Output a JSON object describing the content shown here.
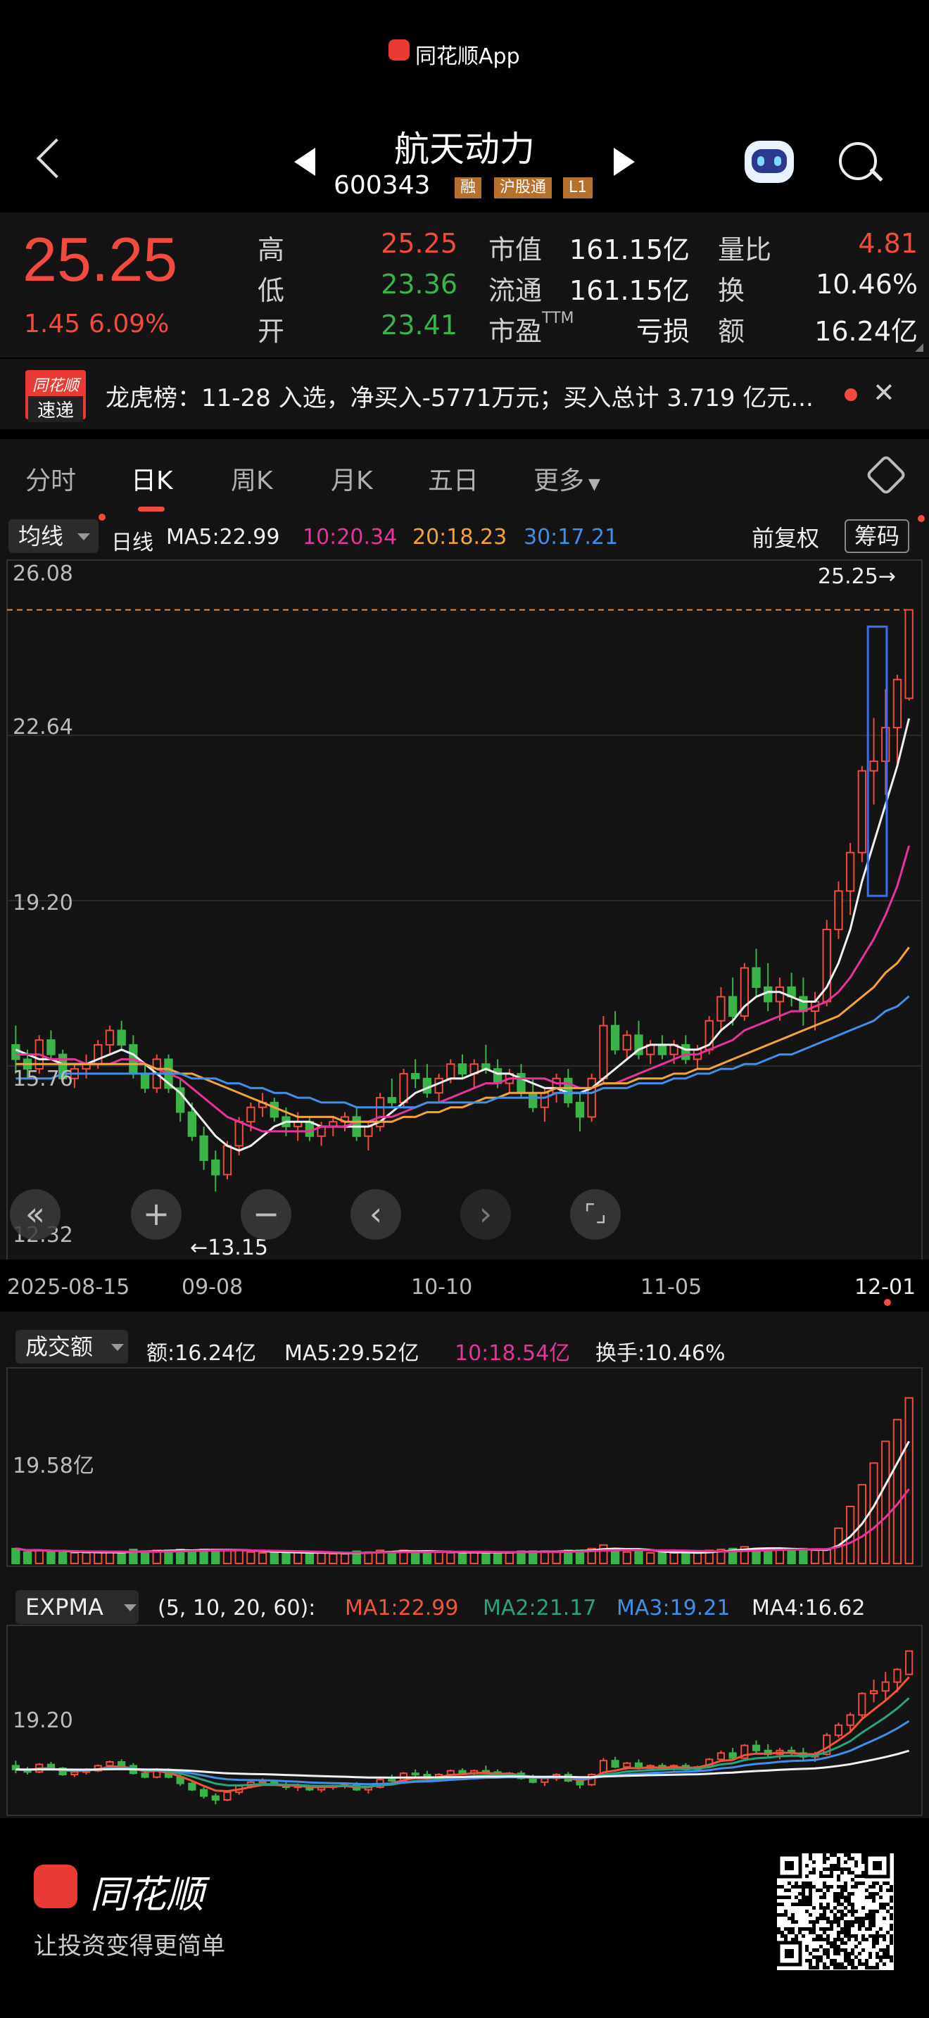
{
  "brand": {
    "app_name": "同花顺App"
  },
  "nav": {
    "stock_name": "航天动力",
    "stock_code": "600343",
    "tags": [
      "融",
      "沪股通",
      "L1"
    ]
  },
  "quote": {
    "price": "25.25",
    "change": "1.45",
    "change_pct": "6.09%",
    "rows": [
      {
        "l1": "高",
        "v1": "25.25",
        "l2": "市值",
        "v2": "161.15亿",
        "l3": "量比",
        "v3": "4.81"
      },
      {
        "l1": "低",
        "v1": "23.36",
        "l2": "流通",
        "v2": "161.15亿",
        "l3": "换",
        "v3": "10.46%"
      },
      {
        "l1": "开",
        "v1": "23.41",
        "l2": "市盈",
        "l2_sup": "TTM",
        "v2": "亏损",
        "l3": "额",
        "v3": "16.24亿"
      }
    ]
  },
  "ticker": {
    "badge_top": "同花顺",
    "badge_bottom": "速递",
    "text": "龙虎榜：11-28 入选，净买入-5771万元；买入总计 3.719 亿元..."
  },
  "tabs": [
    "分时",
    "日K",
    "周K",
    "月K",
    "五日",
    "更多"
  ],
  "active_tab": "日K",
  "kline": {
    "indicator": "均线",
    "period": "日线",
    "ma5": "MA5:22.99",
    "ma10": "10:20.34",
    "ma20": "20:18.23",
    "ma30": "30:17.21",
    "adjust": "前复权",
    "chip": "筹码",
    "y_labels": [
      "26.08",
      "22.64",
      "19.20",
      "15.76",
      "12.32"
    ],
    "high_mark": "25.25→",
    "low_mark": "←13.15",
    "x_labels": [
      "2025-08-15",
      "09-08",
      "10-10",
      "11-05",
      "12-01"
    ]
  },
  "volume": {
    "indicator": "成交额",
    "amount": "额:16.24亿",
    "ma5": "MA5:29.52亿",
    "ma10": "10:18.54亿",
    "turnover": "换手:10.46%",
    "y_label": "19.58亿"
  },
  "expma": {
    "indicator": "EXPMA",
    "params": "(5, 10, 20, 60):",
    "ma1": "MA1:22.99",
    "ma2": "MA2:21.17",
    "ma3": "MA3:19.21",
    "ma4": "MA4:16.62",
    "y_label": "19.20"
  },
  "footer": {
    "brand": "同花顺",
    "slogan": "让投资变得更简单"
  },
  "colors": {
    "up": "#f24a3d",
    "down": "#38b449",
    "ma5": "#f0f0f0",
    "ma10": "#e6349a",
    "ma20": "#f2a33a",
    "ma30": "#3f8fe8",
    "expma_ma2": "#2aa37a"
  },
  "chart_data": {
    "type": "candlestick",
    "title": "航天动力 日K",
    "x": [
      "2025-08-15",
      "09-08",
      "10-10",
      "11-05",
      "12-01"
    ],
    "ylim": [
      12.32,
      26.08
    ],
    "candles": [
      [
        16.2,
        16.6,
        15.6,
        15.9
      ],
      [
        15.9,
        16.1,
        15.5,
        15.7
      ],
      [
        15.7,
        16.4,
        15.6,
        16.3
      ],
      [
        16.3,
        16.5,
        15.9,
        16.0
      ],
      [
        16.0,
        16.1,
        15.4,
        15.5
      ],
      [
        15.5,
        15.8,
        15.3,
        15.7
      ],
      [
        15.7,
        16.0,
        15.5,
        15.8
      ],
      [
        15.8,
        16.3,
        15.7,
        16.2
      ],
      [
        16.2,
        16.6,
        16.0,
        16.5
      ],
      [
        16.5,
        16.7,
        16.1,
        16.2
      ],
      [
        16.2,
        16.4,
        15.5,
        15.6
      ],
      [
        15.6,
        15.8,
        15.2,
        15.3
      ],
      [
        15.3,
        16.0,
        15.2,
        15.9
      ],
      [
        15.9,
        16.0,
        15.2,
        15.3
      ],
      [
        15.3,
        15.5,
        14.6,
        14.8
      ],
      [
        14.8,
        15.0,
        14.2,
        14.3
      ],
      [
        14.3,
        14.5,
        13.6,
        13.8
      ],
      [
        13.8,
        14.0,
        13.15,
        13.5
      ],
      [
        13.5,
        14.2,
        13.4,
        14.1
      ],
      [
        14.1,
        14.7,
        13.9,
        14.6
      ],
      [
        14.6,
        15.0,
        14.4,
        14.9
      ],
      [
        14.9,
        15.2,
        14.7,
        15.0
      ],
      [
        15.0,
        15.1,
        14.6,
        14.7
      ],
      [
        14.7,
        14.9,
        14.3,
        14.5
      ],
      [
        14.5,
        14.8,
        14.2,
        14.6
      ],
      [
        14.6,
        14.7,
        14.2,
        14.3
      ],
      [
        14.3,
        14.6,
        14.1,
        14.5
      ],
      [
        14.5,
        14.7,
        14.3,
        14.6
      ],
      [
        14.6,
        14.8,
        14.4,
        14.7
      ],
      [
        14.7,
        14.9,
        14.2,
        14.3
      ],
      [
        14.3,
        14.6,
        14.0,
        14.5
      ],
      [
        14.5,
        15.2,
        14.4,
        15.1
      ],
      [
        15.1,
        15.5,
        14.9,
        15.0
      ],
      [
        15.0,
        15.7,
        14.9,
        15.6
      ],
      [
        15.6,
        15.9,
        15.3,
        15.5
      ],
      [
        15.5,
        15.8,
        15.1,
        15.2
      ],
      [
        15.2,
        15.6,
        15.0,
        15.5
      ],
      [
        15.5,
        15.9,
        15.4,
        15.8
      ],
      [
        15.8,
        16.0,
        15.5,
        15.6
      ],
      [
        15.6,
        15.9,
        15.3,
        15.8
      ],
      [
        15.8,
        16.2,
        15.6,
        15.7
      ],
      [
        15.7,
        15.9,
        15.3,
        15.4
      ],
      [
        15.4,
        15.7,
        15.2,
        15.6
      ],
      [
        15.6,
        15.8,
        15.1,
        15.2
      ],
      [
        15.2,
        15.5,
        14.8,
        14.9
      ],
      [
        14.9,
        15.3,
        14.6,
        15.2
      ],
      [
        15.2,
        15.6,
        15.0,
        15.5
      ],
      [
        15.5,
        15.7,
        14.9,
        15.0
      ],
      [
        15.0,
        15.2,
        14.4,
        14.7
      ],
      [
        14.7,
        15.6,
        14.6,
        15.5
      ],
      [
        15.5,
        16.8,
        15.4,
        16.6
      ],
      [
        16.6,
        16.9,
        16.0,
        16.1
      ],
      [
        16.1,
        16.5,
        15.9,
        16.4
      ],
      [
        16.4,
        16.7,
        15.9,
        16.0
      ],
      [
        16.0,
        16.3,
        15.8,
        16.2
      ],
      [
        16.2,
        16.4,
        15.9,
        16.0
      ],
      [
        16.0,
        16.3,
        15.8,
        16.2
      ],
      [
        16.2,
        16.4,
        15.8,
        15.9
      ],
      [
        15.9,
        16.2,
        15.7,
        16.1
      ],
      [
        16.1,
        16.8,
        16.0,
        16.7
      ],
      [
        16.7,
        17.4,
        16.5,
        17.2
      ],
      [
        17.2,
        17.6,
        16.6,
        16.8
      ],
      [
        16.8,
        17.9,
        16.7,
        17.8
      ],
      [
        17.8,
        18.2,
        17.2,
        17.4
      ],
      [
        17.4,
        17.9,
        16.9,
        17.1
      ],
      [
        17.1,
        17.6,
        16.7,
        17.4
      ],
      [
        17.4,
        17.7,
        17.0,
        17.2
      ],
      [
        17.2,
        17.6,
        16.6,
        16.9
      ],
      [
        16.9,
        17.3,
        16.5,
        17.1
      ],
      [
        17.1,
        18.8,
        17.0,
        18.6
      ],
      [
        18.6,
        19.6,
        18.4,
        19.4
      ],
      [
        19.4,
        20.4,
        18.9,
        20.2
      ],
      [
        20.2,
        22.0,
        20.0,
        21.9
      ],
      [
        21.9,
        23.0,
        21.2,
        22.1
      ],
      [
        22.1,
        23.6,
        21.4,
        22.8
      ],
      [
        22.8,
        23.9,
        22.0,
        23.8
      ],
      [
        23.41,
        25.25,
        23.36,
        25.25
      ]
    ],
    "series": [
      {
        "name": "MA5",
        "values": [
          16.1,
          16.0,
          15.9,
          15.9,
          15.8,
          15.8,
          15.8,
          15.9,
          16.0,
          16.1,
          16.0,
          15.8,
          15.6,
          15.4,
          15.2,
          14.9,
          14.6,
          14.3,
          14.1,
          14.0,
          14.1,
          14.3,
          14.5,
          14.6,
          14.6,
          14.6,
          14.5,
          14.5,
          14.5,
          14.5,
          14.5,
          14.6,
          14.8,
          15.0,
          15.2,
          15.3,
          15.4,
          15.5,
          15.5,
          15.6,
          15.7,
          15.6,
          15.6,
          15.5,
          15.4,
          15.3,
          15.3,
          15.2,
          15.2,
          15.3,
          15.5,
          15.7,
          15.9,
          16.1,
          16.2,
          16.2,
          16.2,
          16.1,
          16.1,
          16.2,
          16.5,
          16.7,
          17.0,
          17.2,
          17.3,
          17.3,
          17.2,
          17.1,
          17.1,
          17.4,
          17.9,
          18.6,
          19.6,
          20.4,
          21.2,
          22.0,
          22.99
        ]
      },
      {
        "name": "MA10",
        "values": [
          16.0,
          16.0,
          16.0,
          15.9,
          15.9,
          15.9,
          15.8,
          15.8,
          15.8,
          15.9,
          15.9,
          15.8,
          15.7,
          15.6,
          15.5,
          15.3,
          15.1,
          14.9,
          14.7,
          14.6,
          14.5,
          14.4,
          14.4,
          14.4,
          14.4,
          14.4,
          14.5,
          14.5,
          14.5,
          14.6,
          14.6,
          14.7,
          14.7,
          14.8,
          14.9,
          15.0,
          15.0,
          15.1,
          15.2,
          15.3,
          15.4,
          15.4,
          15.5,
          15.5,
          15.5,
          15.5,
          15.4,
          15.4,
          15.3,
          15.3,
          15.4,
          15.4,
          15.5,
          15.6,
          15.7,
          15.8,
          15.9,
          16.0,
          16.0,
          16.1,
          16.2,
          16.3,
          16.5,
          16.6,
          16.7,
          16.8,
          16.9,
          16.9,
          17.0,
          17.1,
          17.3,
          17.6,
          18.0,
          18.4,
          18.9,
          19.5,
          20.34
        ]
      },
      {
        "name": "MA20",
        "values": [
          15.8,
          15.8,
          15.8,
          15.8,
          15.8,
          15.8,
          15.8,
          15.8,
          15.8,
          15.8,
          15.8,
          15.8,
          15.7,
          15.7,
          15.6,
          15.6,
          15.5,
          15.4,
          15.3,
          15.2,
          15.1,
          15.0,
          14.9,
          14.8,
          14.7,
          14.7,
          14.7,
          14.7,
          14.6,
          14.6,
          14.6,
          14.6,
          14.6,
          14.7,
          14.7,
          14.8,
          14.8,
          14.9,
          14.9,
          15.0,
          15.1,
          15.1,
          15.2,
          15.2,
          15.2,
          15.2,
          15.3,
          15.3,
          15.3,
          15.3,
          15.4,
          15.4,
          15.4,
          15.5,
          15.5,
          15.5,
          15.6,
          15.6,
          15.7,
          15.7,
          15.8,
          15.9,
          16.0,
          16.1,
          16.2,
          16.3,
          16.4,
          16.5,
          16.6,
          16.7,
          16.8,
          17.0,
          17.2,
          17.4,
          17.7,
          17.9,
          18.23
        ]
      },
      {
        "name": "MA30",
        "values": [
          15.5,
          15.5,
          15.5,
          15.5,
          15.6,
          15.6,
          15.6,
          15.6,
          15.6,
          15.6,
          15.6,
          15.6,
          15.6,
          15.6,
          15.6,
          15.5,
          15.5,
          15.5,
          15.4,
          15.4,
          15.3,
          15.3,
          15.2,
          15.2,
          15.1,
          15.1,
          15.0,
          15.0,
          15.0,
          14.9,
          14.9,
          14.9,
          14.9,
          14.9,
          14.9,
          15.0,
          15.0,
          15.0,
          15.0,
          15.0,
          15.0,
          15.1,
          15.1,
          15.1,
          15.1,
          15.1,
          15.2,
          15.2,
          15.2,
          15.2,
          15.3,
          15.3,
          15.3,
          15.4,
          15.4,
          15.4,
          15.5,
          15.5,
          15.6,
          15.6,
          15.7,
          15.7,
          15.8,
          15.8,
          15.9,
          16.0,
          16.0,
          16.1,
          16.2,
          16.3,
          16.4,
          16.5,
          16.6,
          16.7,
          16.9,
          17.0,
          17.21
        ]
      }
    ]
  }
}
